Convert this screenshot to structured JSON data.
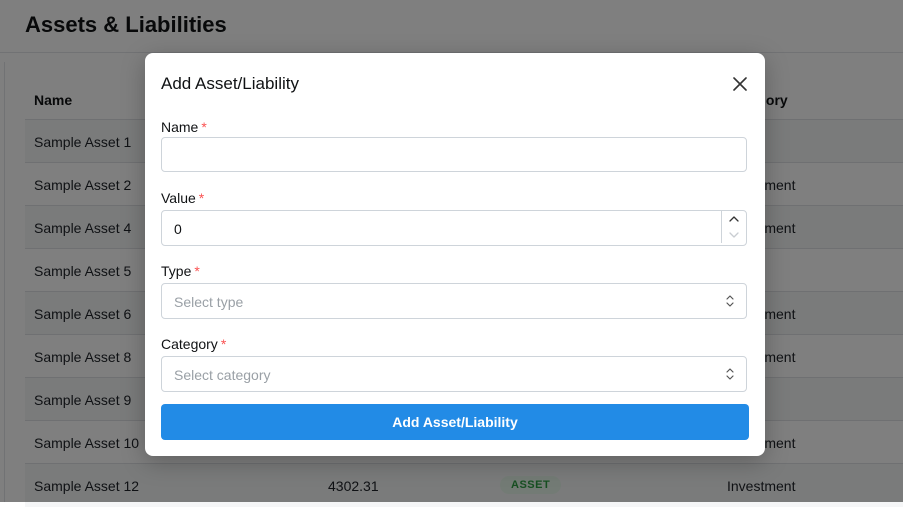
{
  "page": {
    "title": "Assets & Liabilities",
    "columns": {
      "name": "Name",
      "category": "Category"
    }
  },
  "table": {
    "rows": [
      {
        "name": "Sample Asset 1",
        "value": "",
        "type": "",
        "category": ""
      },
      {
        "name": "Sample Asset 2",
        "value": "",
        "type": "",
        "category": "Investment"
      },
      {
        "name": "Sample Asset 4",
        "value": "",
        "type": "",
        "category": "Investment"
      },
      {
        "name": "Sample Asset 5",
        "value": "",
        "type": "",
        "category": ""
      },
      {
        "name": "Sample Asset 6",
        "value": "",
        "type": "",
        "category": "Investment"
      },
      {
        "name": "Sample Asset 8",
        "value": "",
        "type": "",
        "category": "Investment"
      },
      {
        "name": "Sample Asset 9",
        "value": "",
        "type": "",
        "category": ""
      },
      {
        "name": "Sample Asset 10",
        "value": "",
        "type": "",
        "category": "Investment"
      },
      {
        "name": "Sample Asset 12",
        "value": "4302.31",
        "type": "ASSET",
        "category": "Investment"
      }
    ]
  },
  "modal": {
    "title": "Add Asset/Liability",
    "required_marker": "*",
    "fields": {
      "name": {
        "label": "Name",
        "value": ""
      },
      "value": {
        "label": "Value",
        "value": "0"
      },
      "type": {
        "label": "Type",
        "placeholder": "Select type"
      },
      "category": {
        "label": "Category",
        "placeholder": "Select category"
      }
    },
    "submit_label": "Add Asset/Liability"
  },
  "colors": {
    "accent": "#228be6",
    "required": "#fa5252",
    "badge_text": "#2f9e44",
    "badge_bg": "#e6f6ea"
  },
  "icons": {
    "close": "close-icon",
    "step_up": "chevron-up-icon",
    "step_down": "chevron-down-icon",
    "select": "selector-icon"
  }
}
